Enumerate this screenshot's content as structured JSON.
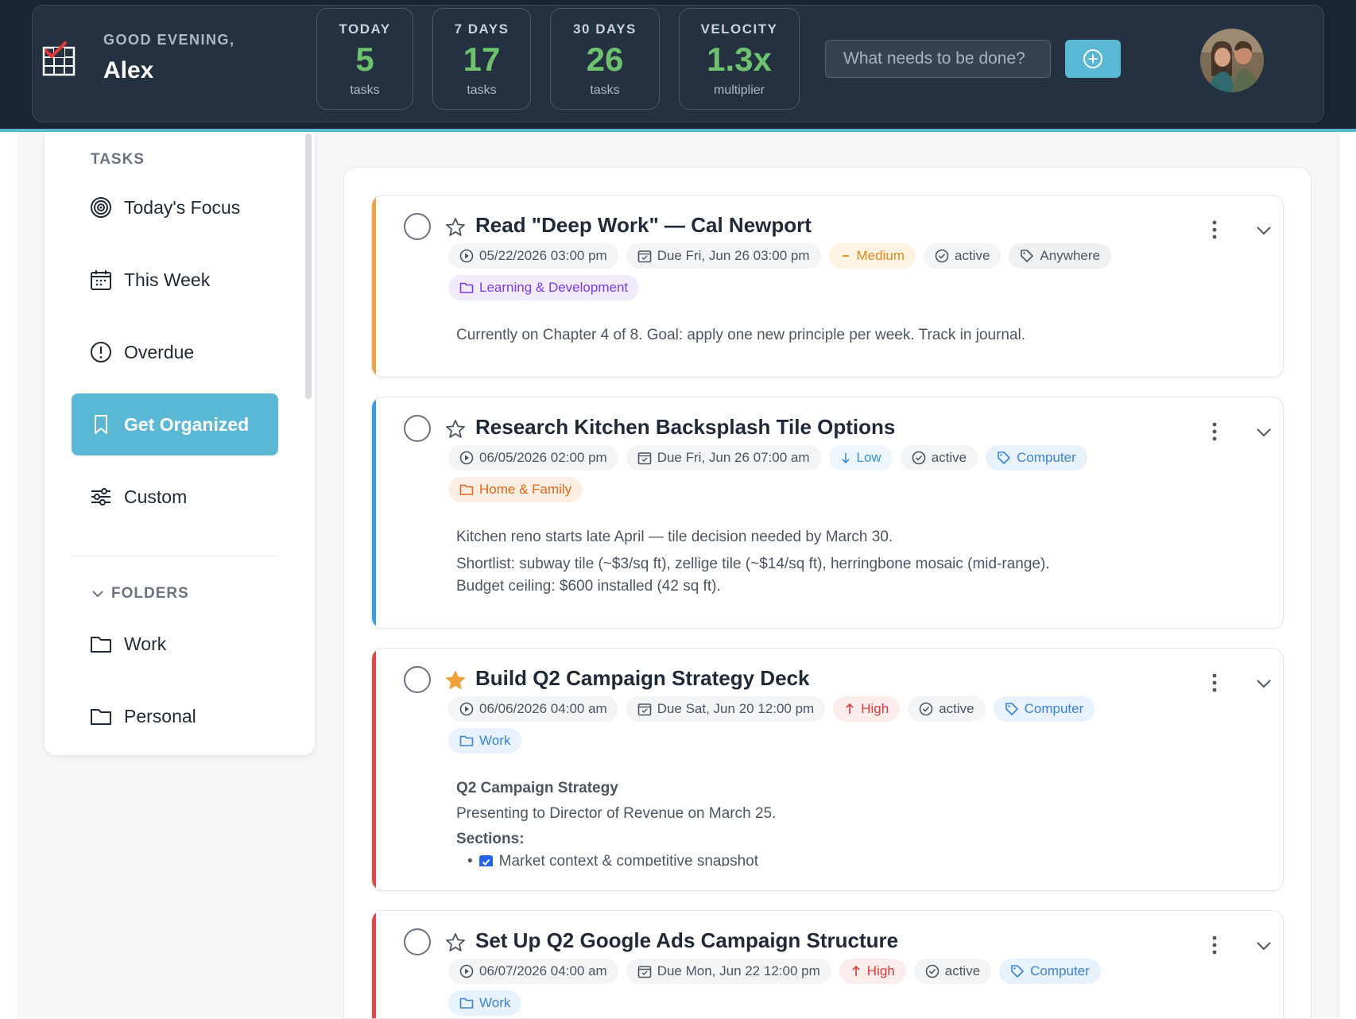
{
  "header": {
    "greeting": "GOOD EVENING,",
    "user_name": "Alex",
    "stats": [
      {
        "label": "TODAY",
        "value": "5",
        "sub": "tasks"
      },
      {
        "label": "7 DAYS",
        "value": "17",
        "sub": "tasks"
      },
      {
        "label": "30 DAYS",
        "value": "26",
        "sub": "tasks"
      },
      {
        "label": "VELOCITY",
        "value": "1.3x",
        "sub": "multiplier"
      }
    ],
    "search_placeholder": "What needs to be done?",
    "accent_color": "#5ab8d4",
    "stat_color": "#6ec26e"
  },
  "sidebar": {
    "section_label": "TASKS",
    "items": [
      {
        "label": "Today's Focus",
        "icon": "target-icon"
      },
      {
        "label": "This Week",
        "icon": "calendar-icon"
      },
      {
        "label": "Overdue",
        "icon": "alert-circle-icon"
      },
      {
        "label": "Get Organized",
        "icon": "bookmark-icon",
        "active": true
      },
      {
        "label": "Custom",
        "icon": "sliders-icon"
      }
    ],
    "folders_label": "FOLDERS",
    "folders": [
      {
        "label": "Work",
        "icon": "folder-icon"
      },
      {
        "label": "Personal",
        "icon": "folder-icon"
      }
    ]
  },
  "tasks": [
    {
      "title": "Read \"Deep Work\" — Cal Newport",
      "starred": false,
      "accent": "#f0a33a",
      "created": "05/22/2026 03:00 pm",
      "due": "Due Fri, Jun 26 03:00 pm",
      "priority": "Medium",
      "status": "active",
      "context": "Anywhere",
      "folder": "Learning & Development",
      "notes": [
        "Currently on Chapter 4 of 8. Goal: apply one new principle per week. Track in journal."
      ]
    },
    {
      "title": "Research Kitchen Backsplash Tile Options",
      "starred": false,
      "accent": "#3b9be0",
      "created": "06/05/2026 02:00 pm",
      "due": "Due Fri, Jun 26 07:00 am",
      "priority": "Low",
      "status": "active",
      "context": "Computer",
      "folder": "Home & Family",
      "notes": [
        "Kitchen reno starts late April — tile decision needed by March 30.",
        "Shortlist: subway tile (~$3/sq ft), zellige tile (~$14/sq ft), herringbone mosaic (mid-range).",
        "Budget ceiling: $600 installed (42 sq ft)."
      ]
    },
    {
      "title": "Build Q2 Campaign Strategy Deck",
      "starred": true,
      "accent": "#e04848",
      "created": "06/06/2026 04:00 am",
      "due": "Due Sat, Jun 20 12:00 pm",
      "priority": "High",
      "status": "active",
      "context": "Computer",
      "folder": "Work",
      "notes_heading": "Q2 Campaign Strategy",
      "notes_line": "Presenting to Director of Revenue on March 25.",
      "notes_sections": "Sections:",
      "notes_bullet": "Market context & competitive snapshot"
    },
    {
      "title": "Set Up Q2 Google Ads Campaign Structure",
      "starred": false,
      "accent": "#e04848",
      "created": "06/07/2026 04:00 am",
      "due": "Due Mon, Jun 22 12:00 pm",
      "priority": "High",
      "status": "active",
      "context": "Computer",
      "folder": "Work"
    }
  ]
}
